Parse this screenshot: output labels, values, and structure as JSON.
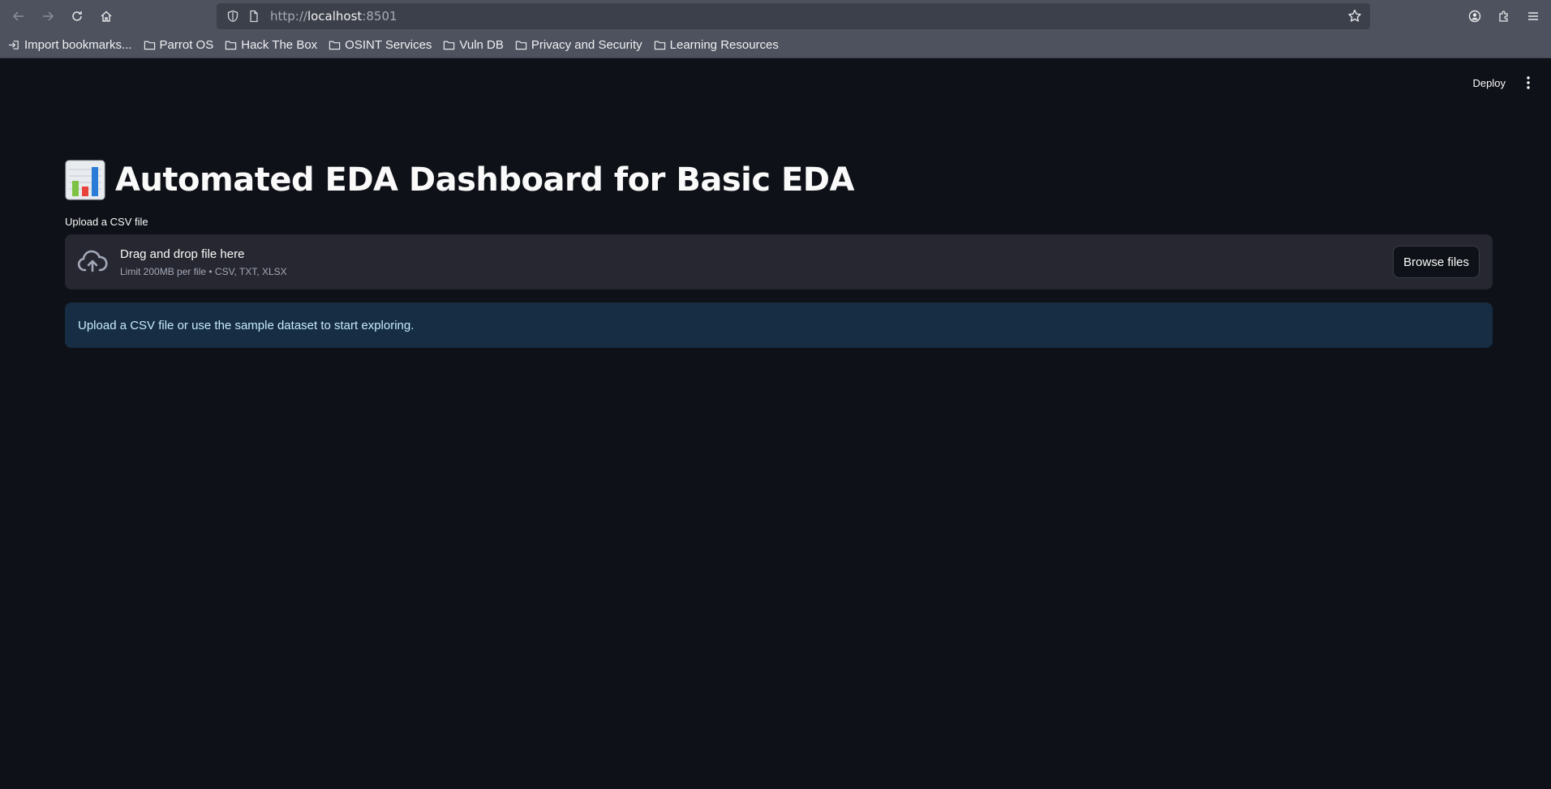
{
  "browser": {
    "url_prefix": "http://",
    "url_host": "localhost",
    "url_suffix": ":8501",
    "bookmarks": [
      {
        "label": "Import bookmarks...",
        "icon": "import-icon"
      },
      {
        "label": "Parrot OS",
        "icon": "folder-icon"
      },
      {
        "label": "Hack The Box",
        "icon": "folder-icon"
      },
      {
        "label": "OSINT Services",
        "icon": "folder-icon"
      },
      {
        "label": "Vuln DB",
        "icon": "folder-icon"
      },
      {
        "label": "Privacy and Security",
        "icon": "folder-icon"
      },
      {
        "label": "Learning Resources",
        "icon": "folder-icon"
      }
    ]
  },
  "header": {
    "deploy_label": "Deploy"
  },
  "main": {
    "title": "Automated EDA Dashboard for Basic EDA",
    "title_icon": "bar-chart-emoji",
    "uploader": {
      "label": "Upload a CSV file",
      "drop_text": "Drag and drop file here",
      "limit_text": "Limit 200MB per file • CSV, TXT, XLSX",
      "browse_label": "Browse files"
    },
    "info_text": "Upload a CSV file or use the sample dataset to start exploring."
  },
  "colors": {
    "app_bg": "#0e1117",
    "dropzone_bg": "#262730",
    "info_bg": "#172d43",
    "info_text": "#c7ebff",
    "chrome_bg": "#4d525e"
  }
}
